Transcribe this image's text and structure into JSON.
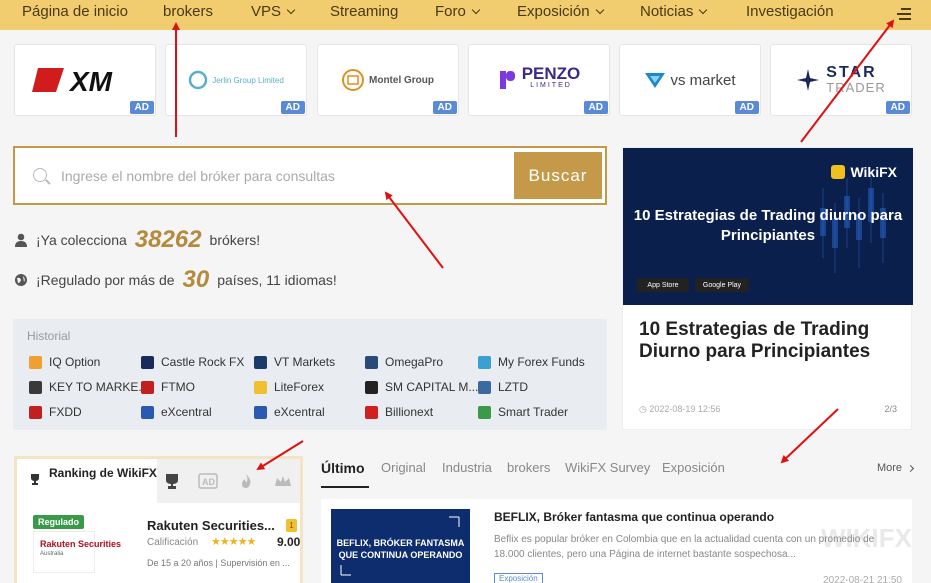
{
  "nav": {
    "items": [
      {
        "label": "Página de inicio",
        "has_dropdown": false
      },
      {
        "label": "brokers",
        "has_dropdown": false
      },
      {
        "label": "VPS",
        "has_dropdown": true
      },
      {
        "label": "Streaming",
        "has_dropdown": false
      },
      {
        "label": "Foro",
        "has_dropdown": true
      },
      {
        "label": "Exposición",
        "has_dropdown": true
      },
      {
        "label": "Noticias",
        "has_dropdown": true
      },
      {
        "label": "Investigación",
        "has_dropdown": false
      }
    ],
    "menu_icon": "menu-icon",
    "bg_color": "#f1cd6f"
  },
  "ads": {
    "tag": "AD",
    "brands": [
      {
        "name": "XM",
        "text": "XM"
      },
      {
        "name": "Jerlin Group Limited",
        "text": "Jerlin Group Limited"
      },
      {
        "name": "Montel Group",
        "text": "Montel Group"
      },
      {
        "name": "PENZO LIMITED",
        "text": "PENZO",
        "sub": "LIMITED"
      },
      {
        "name": "vs market",
        "text": "vs market"
      },
      {
        "name": "STAR TRADER",
        "text": "STAR",
        "sub": "TRADER"
      }
    ]
  },
  "search": {
    "placeholder": "Ingrese el nombre del bróker para consultas",
    "button_label": "Buscar",
    "accent_color": "#c49a4a"
  },
  "stats": {
    "collect_prefix": "¡Ya colecciona",
    "collect_count": "38262",
    "collect_suffix": "brókers!",
    "reg_prefix": "¡Regulado por más de",
    "reg_count": "30",
    "reg_suffix": "países, 11 idiomas!"
  },
  "history": {
    "title": "Historial",
    "items": [
      {
        "label": "IQ Option",
        "color": "#f0a030"
      },
      {
        "label": "Castle Rock FX",
        "color": "#1a2a5a"
      },
      {
        "label": "VT Markets",
        "color": "#1a3a6a"
      },
      {
        "label": "OmegaPro",
        "color": "#2a4a7a"
      },
      {
        "label": "My Forex Funds",
        "color": "#3aa0d0"
      },
      {
        "label": "KEY TO MARKE...",
        "color": "#3a3a3a"
      },
      {
        "label": "FTMO",
        "color": "#c02020"
      },
      {
        "label": "LiteForex",
        "color": "#f0c030"
      },
      {
        "label": "SM CAPITAL M...",
        "color": "#222"
      },
      {
        "label": "LZTD",
        "color": "#3a6aa0"
      },
      {
        "label": "FXDD",
        "color": "#c02020"
      },
      {
        "label": "eXcentral",
        "color": "#2a5ab0"
      },
      {
        "label": "eXcentral",
        "color": "#2a5ab0"
      },
      {
        "label": "Billionext",
        "color": "#d02020"
      },
      {
        "label": "Smart Trader",
        "color": "#3a9a4a"
      }
    ]
  },
  "featured": {
    "banner_logo": "WikiFX",
    "banner_heading": "10 Estrategias de Trading diurno para Principiantes",
    "store1": "App Store",
    "store2": "Google Play",
    "title": "10 Estrategias de Trading Diurno para Principiantes",
    "date": "2022-08-19 12:56",
    "page": "2/3"
  },
  "ranking": {
    "title": "Ranking de WikiFX",
    "tab_icons": [
      "trophy-icon",
      "ad-icon",
      "fire-icon",
      "crown-icon"
    ],
    "entry": {
      "badge": "Regulado",
      "logo_text": "Rakuten Securities",
      "logo_sub": "Australia",
      "name": "Rakuten Securities...",
      "rating_label": "Calificación",
      "stars": "★★★★★",
      "score": "9.00",
      "meta": "De 15 a 20 años | Supervisión en ..."
    }
  },
  "news_tabs": {
    "items": [
      "Último",
      "Original",
      "Industria",
      "brokers",
      "WikiFX Survey",
      "Exposición"
    ],
    "more": "More"
  },
  "news": {
    "image_text": "BEFLIX, BRÓKER FANTASMA QUE CONTINUA OPERANDO",
    "title": "BEFLIX, Bróker fantasma que continua operando",
    "desc": "Beflix es popular bróker en Colombia que en la actualidad cuenta con un promedio de 18.000 clientes, pero una Página de internet bastante sospechosa...",
    "tag": "Exposición",
    "date": "2022-08-21 21:50",
    "watermark": "WIKIFX"
  }
}
